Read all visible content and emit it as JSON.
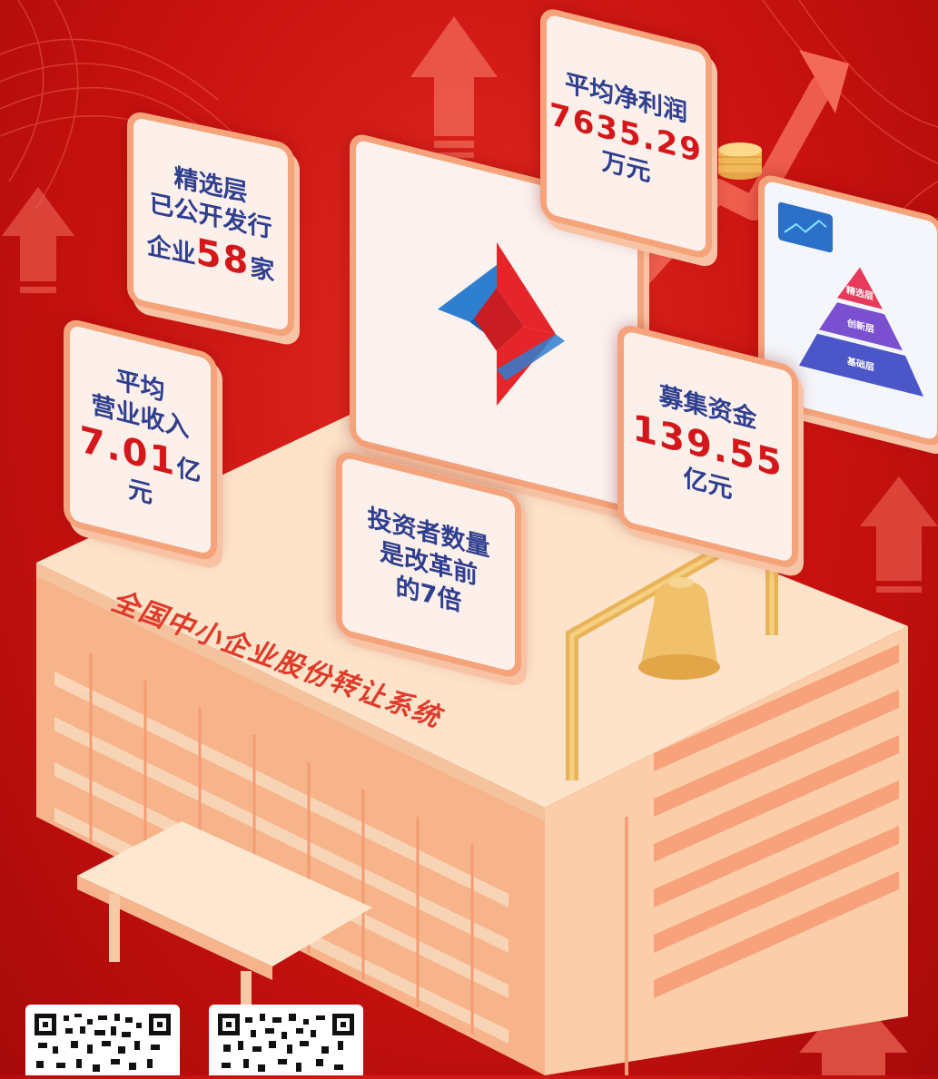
{
  "cards": {
    "selected_tier": {
      "line1": "精选层",
      "line2": "已公开发行",
      "prefix": "企业",
      "value": "58",
      "suffix": "家"
    },
    "avg_revenue": {
      "line1": "平均",
      "line2": "营业收入",
      "value": "7.01",
      "unit": "亿元"
    },
    "avg_profit": {
      "line1": "平均净利润",
      "value": "7635.29",
      "unit": "万元"
    },
    "funds_raised": {
      "line1": "募集资金",
      "value": "139.55",
      "unit": "亿元"
    },
    "investors": {
      "line1": "投资者数量",
      "line2": "是改革前",
      "line3": "的7倍"
    }
  },
  "building_title": "全国中小企业股份转让系统",
  "pyramid": {
    "top": "精选层",
    "middle": "创新层",
    "bottom": "基础层"
  },
  "colors": {
    "background": "#c8120f",
    "card_border": "#f4a37a",
    "card_fill": "#fdf0ea",
    "number_red": "#d4171b",
    "label_blue": "#2f3f8f",
    "building": "#fbd4b4"
  }
}
